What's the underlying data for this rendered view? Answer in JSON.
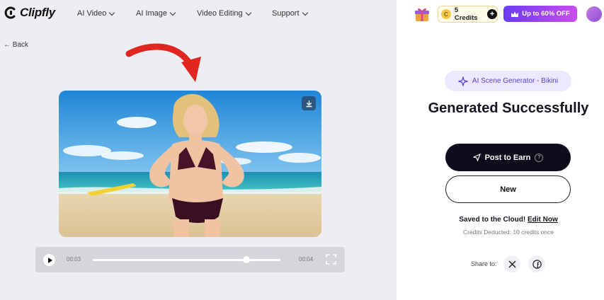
{
  "header": {
    "logo_text": "Clipfly",
    "nav": [
      {
        "label": "AI Video"
      },
      {
        "label": "AI Image"
      },
      {
        "label": "Video Editing"
      },
      {
        "label": "Support"
      }
    ]
  },
  "back_label": "Back",
  "player": {
    "current_time": "00:03",
    "end_time": "00:04",
    "progress": 0.82
  },
  "account": {
    "credits_label": "5 Credits",
    "coin_symbol": "C",
    "plus_label": "+",
    "promo_label": "Up to 60% OFF"
  },
  "result": {
    "tool_tag": "AI Scene Generator - Bikini",
    "title": "Generated Successfully",
    "post_button": "Post to Earn",
    "help_symbol": "?",
    "new_button": "New",
    "saved_text": "Saved to the Cloud!",
    "edit_link": "Edit Now",
    "credits_deducted": "Credits Deducted: 10 credits once",
    "share_label": "Share to:"
  },
  "colors": {
    "accent_purple": "#6a3cf2",
    "primary_dark": "#0d0d1c",
    "arrow_red": "#e0261f"
  }
}
